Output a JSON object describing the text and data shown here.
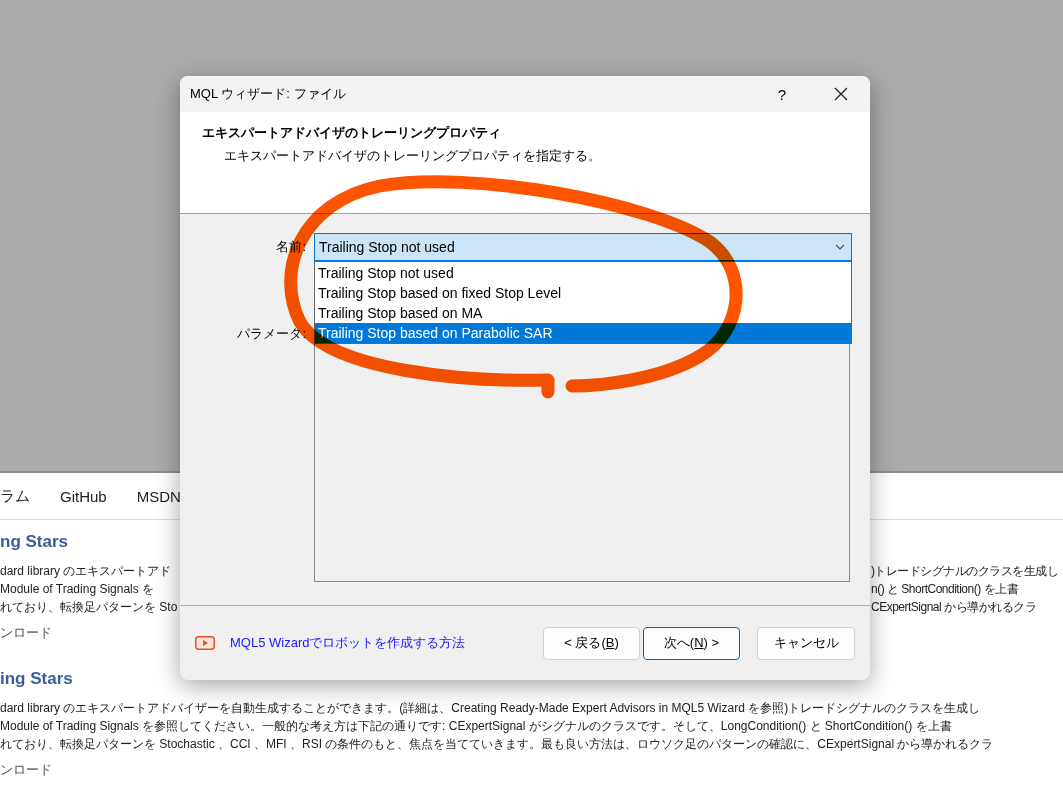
{
  "background_page": {
    "nav": [
      "ラム",
      "GitHub",
      "MSDN"
    ],
    "sections": [
      {
        "heading": "ng Stars",
        "lines": [
          {
            "left": "dard library のエキスパートアド",
            "right": ")トレードシグナルのクラスを生成し"
          },
          {
            "left": "Module of Trading Signals を",
            "right": "n() と ShortCondition() を上書"
          },
          {
            "left": "れており、転換足パターンを Sto",
            "right": "CExpertSignal から導かれるクラ"
          }
        ],
        "download": "ンロード"
      },
      {
        "heading": "ing Stars",
        "lines": [
          {
            "text": "dard library のエキスパートアドバイザーを自動生成することができます。(詳細は、Creating Ready-Made Expert Advisors in MQL5 Wizard を参照)トレードシグナルのクラスを生成し"
          },
          {
            "text": "Module of Trading Signals を参照してください。一般的な考え方は下記の通りです: CExpertSignal がシグナルのクラスです。そして、LongCondition() と ShortCondition() を上書"
          },
          {
            "text": "れており、転換足パターンを Stochastic 、CCI 、MFI 、RSI の条件のもと、焦点を当てていきます。最も良い方法は、ロウソク足のパターンの確認に、CExpertSignal から導かれるクラ"
          }
        ],
        "download": "ンロード"
      }
    ]
  },
  "dialog": {
    "title": "MQL ウィザード: ファイル",
    "help": "?",
    "header": {
      "title": "エキスパートアドバイザのトレーリングプロパティ",
      "subtitle": "エキスパートアドバイザのトレーリングプロパティを指定する。"
    },
    "name_field": {
      "label": "名前:",
      "value": "Trailing Stop not used",
      "expanded": true
    },
    "options": [
      {
        "label": "Trailing Stop not used",
        "selected": false
      },
      {
        "label": "Trailing Stop based on fixed Stop Level",
        "selected": false
      },
      {
        "label": "Trailing Stop based on MA",
        "selected": false
      },
      {
        "label": "Trailing Stop based on Parabolic SAR",
        "selected": true
      }
    ],
    "parameters": {
      "label": "パラメータ:"
    },
    "link": "MQL5 Wizardでロボットを作成する方法",
    "buttons": [
      {
        "before": "< 戻る(",
        "mnemonic": "B",
        "after": ")",
        "default": false
      },
      {
        "before": "次へ(",
        "mnemonic": "N",
        "after": ") >",
        "default": true
      },
      {
        "before": "キャンセル",
        "default": false
      }
    ]
  },
  "annotation": {
    "kind": "freehand_circle"
  }
}
